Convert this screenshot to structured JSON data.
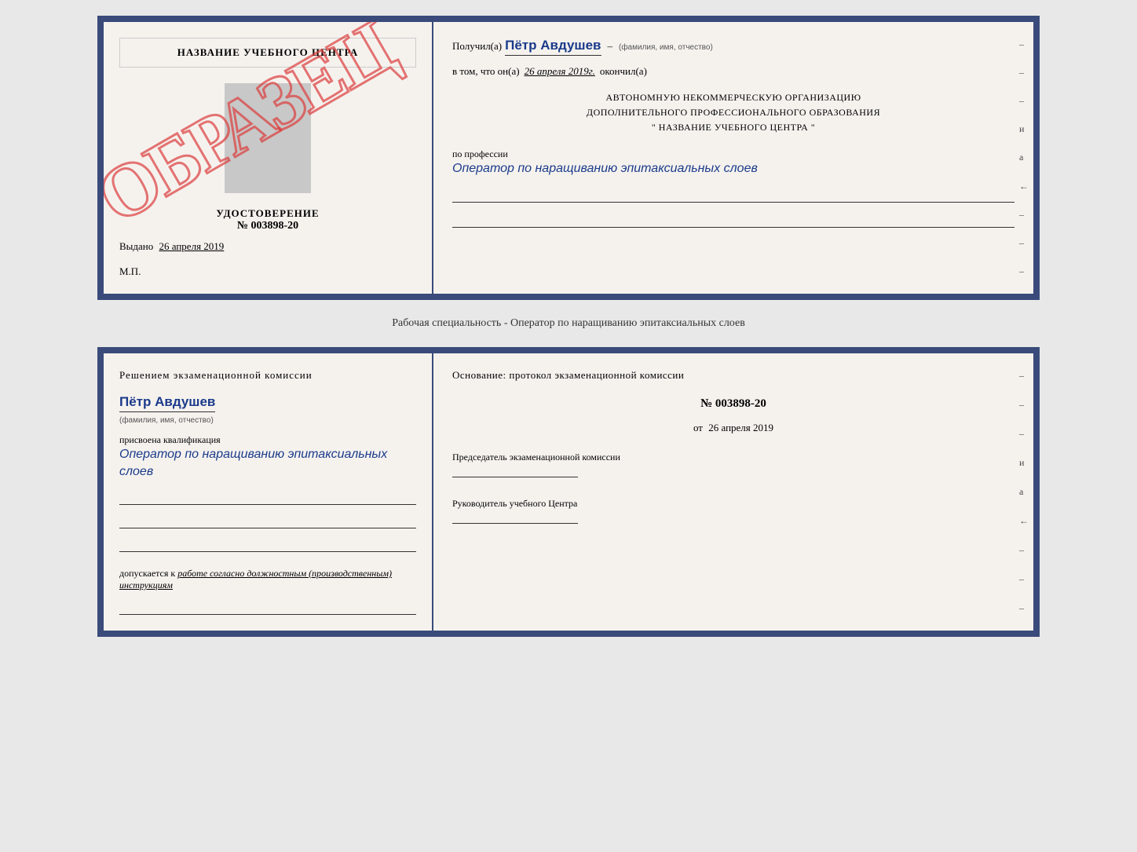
{
  "top_document": {
    "left": {
      "training_center_title": "НАЗВАНИЕ УЧЕБНОГО ЦЕНТРА",
      "udostoverenie_label": "УДОСТОВЕРЕНИЕ",
      "udostoverenie_number": "№ 003898-20",
      "vydano_label": "Выдано",
      "vydano_date": "26 апреля 2019",
      "mp_label": "М.П.",
      "obrazets_text": "ОБРАЗЕЦ"
    },
    "right": {
      "poluchil_prefix": "Получил(а)",
      "poluchil_name": "Пётр Авдушев",
      "poluchil_sub": "(фамилия, имя, отчество)",
      "dash": "–",
      "vtom_prefix": "в том, что он(а)",
      "vtom_date": "26 апреля 2019г.",
      "okonchill_suffix": "окончил(а)",
      "org_line1": "АВТОНОМНУЮ НЕКОММЕРЧЕСКУЮ ОРГАНИЗАЦИЮ",
      "org_line2": "ДОПОЛНИТЕЛЬНОГО ПРОФЕССИОНАЛЬНОГО ОБРАЗОВАНИЯ",
      "org_line3": "\" НАЗВАНИЕ УЧЕБНОГО ЦЕНТРА \"",
      "po_professii_label": "по профессии",
      "po_professii_value": "Оператор по наращиванию эпитаксиальных слоев"
    }
  },
  "separator": {
    "text": "Рабочая специальность - Оператор по наращиванию эпитаксиальных слоев"
  },
  "bottom_document": {
    "left": {
      "resheniem_label": "Решением экзаменационной комиссии",
      "name": "Пётр Авдушев",
      "name_sub": "(фамилия, имя, отчество)",
      "prisvoena_label": "присвоена квалификация",
      "kvalif_value": "Оператор по наращиванию эпитаксиальных слоев",
      "dopuskaetsya_prefix": "допускается к",
      "dopuskaetsya_italic": "работе согласно должностным (производственным) инструкциям"
    },
    "right": {
      "osnovaniye_label": "Основание: протокол экзаменационной комиссии",
      "protocol_number": "№ 003898-20",
      "ot_prefix": "от",
      "ot_date": "26 апреля 2019",
      "predsedatel_label": "Председатель экзаменационной комиссии",
      "rukovoditel_label": "Руководитель учебного Центра"
    }
  },
  "dashes": [
    "–",
    "–",
    "–",
    "и",
    "а",
    "←",
    "–",
    "–",
    "–"
  ]
}
